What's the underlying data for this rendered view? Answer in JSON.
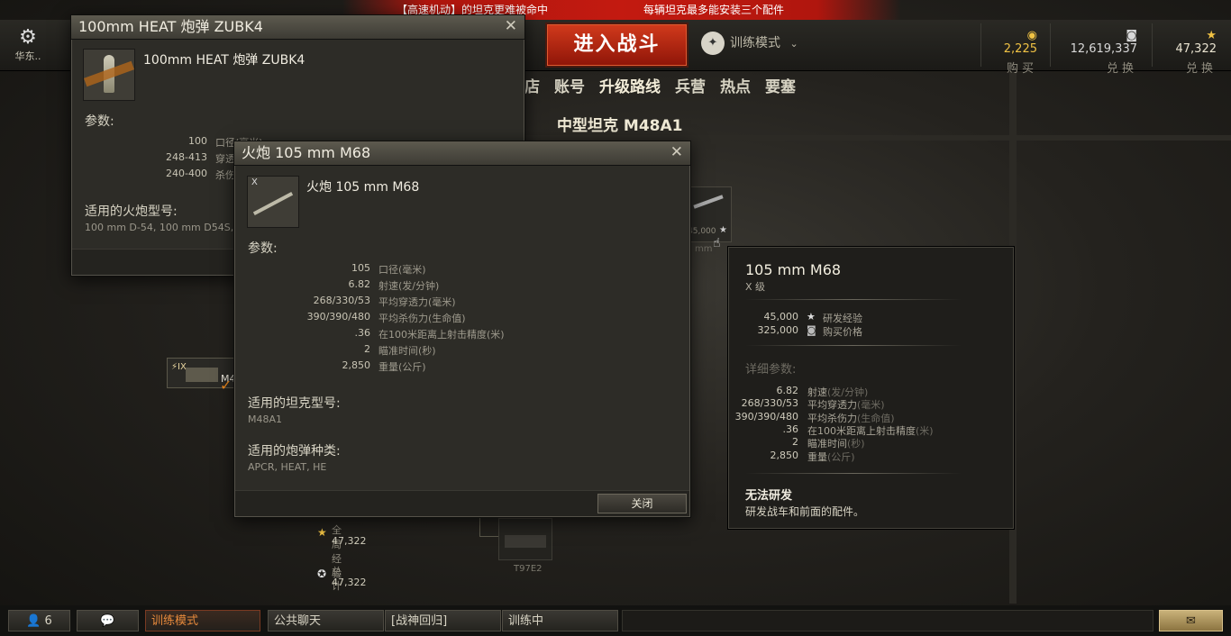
{
  "marquee": {
    "left": "【高速机动】的坦克更难被命中",
    "right": "每辆坦克最多能安装三个配件"
  },
  "topbar": {
    "settings_label": "华东..",
    "battle_button": "进入战斗",
    "mode_label": "训练模式",
    "gold": {
      "value": "2,225",
      "label": "购买"
    },
    "credits": {
      "value": "12,619,337",
      "label": "兑换"
    },
    "free_xp": {
      "value": "47,322",
      "label": "兑换"
    }
  },
  "nav": {
    "tabs": [
      "店",
      "账号",
      "升级路线",
      "兵营",
      "热点",
      "要塞"
    ]
  },
  "tank_title": "中型坦克 M48A1",
  "tree": {
    "node_level": "IX",
    "node_label": "M4",
    "t97_label": "T97E2",
    "global_xp_label": "全局经验",
    "global_xp_value": "47,322",
    "total_label": "总计",
    "total_value": "47,322",
    "gun_node_cost": "45,000",
    "gun_node_label": "mm"
  },
  "shell_window": {
    "title": "100mm HEAT 炮弹 ZUBK4",
    "name": "100mm HEAT 炮弹 ZUBK4",
    "params_header": "参数:",
    "params": [
      {
        "value": "100",
        "name": "口径(毫米)"
      },
      {
        "value": "248-413",
        "name": "穿透"
      },
      {
        "value": "240-400",
        "name": "杀伤"
      }
    ],
    "guns_header": "适用的火炮型号:",
    "guns": "100 mm D-54, 100 mm D54S, 10"
  },
  "gun_window": {
    "title": "火炮 105 mm M68",
    "thumb_tier": "X",
    "name": "火炮 105 mm M68",
    "params_header": "参数:",
    "params": [
      {
        "value": "105",
        "name": "口径(毫米)"
      },
      {
        "value": "6.82",
        "name": "射速(发/分钟)"
      },
      {
        "value": "268/330/53",
        "name": "平均穿透力(毫米)"
      },
      {
        "value": "390/390/480",
        "name": "平均杀伤力(生命值)"
      },
      {
        "value": ".36",
        "name": "在100米距离上射击精度(米)"
      },
      {
        "value": "2",
        "name": "瞄准时间(秒)"
      },
      {
        "value": "2,850",
        "name": "重量(公斤)"
      }
    ],
    "tanks_header": "适用的坦克型号:",
    "tanks": "M48A1",
    "shells_header": "适用的炮弹种类:",
    "shells": "APCR, HEAT, HE",
    "close_button": "关闭"
  },
  "tooltip": {
    "title": "105 mm M68",
    "tier": "X 级",
    "costs": [
      {
        "value": "45,000",
        "icon": "★",
        "name": "研发经验"
      },
      {
        "value": "325,000",
        "icon": "◙",
        "name": "购买价格"
      }
    ],
    "details_header": "详细参数:",
    "details": [
      {
        "value": "6.82",
        "name": "射速",
        "unit": "(发/分钟)"
      },
      {
        "value": "268/330/53",
        "name": "平均穿透力",
        "unit": "(毫米)"
      },
      {
        "value": "390/390/480",
        "name": "平均杀伤力",
        "unit": "(生命值)"
      },
      {
        "value": ".36",
        "name": "在100米距离上射击精度",
        "unit": "(米)"
      },
      {
        "value": "2",
        "name": "瞄准时间",
        "unit": "(秒)"
      },
      {
        "value": "2,850",
        "name": "重量",
        "unit": "(公斤)"
      }
    ],
    "warning_title": "无法研发",
    "warning_text": "研发战车和前面的配件。"
  },
  "bottombar": {
    "players": "6",
    "training": "训练模式",
    "public_chat": "公共聊天",
    "channel": "[战神回归]",
    "training_status": "训练中"
  }
}
